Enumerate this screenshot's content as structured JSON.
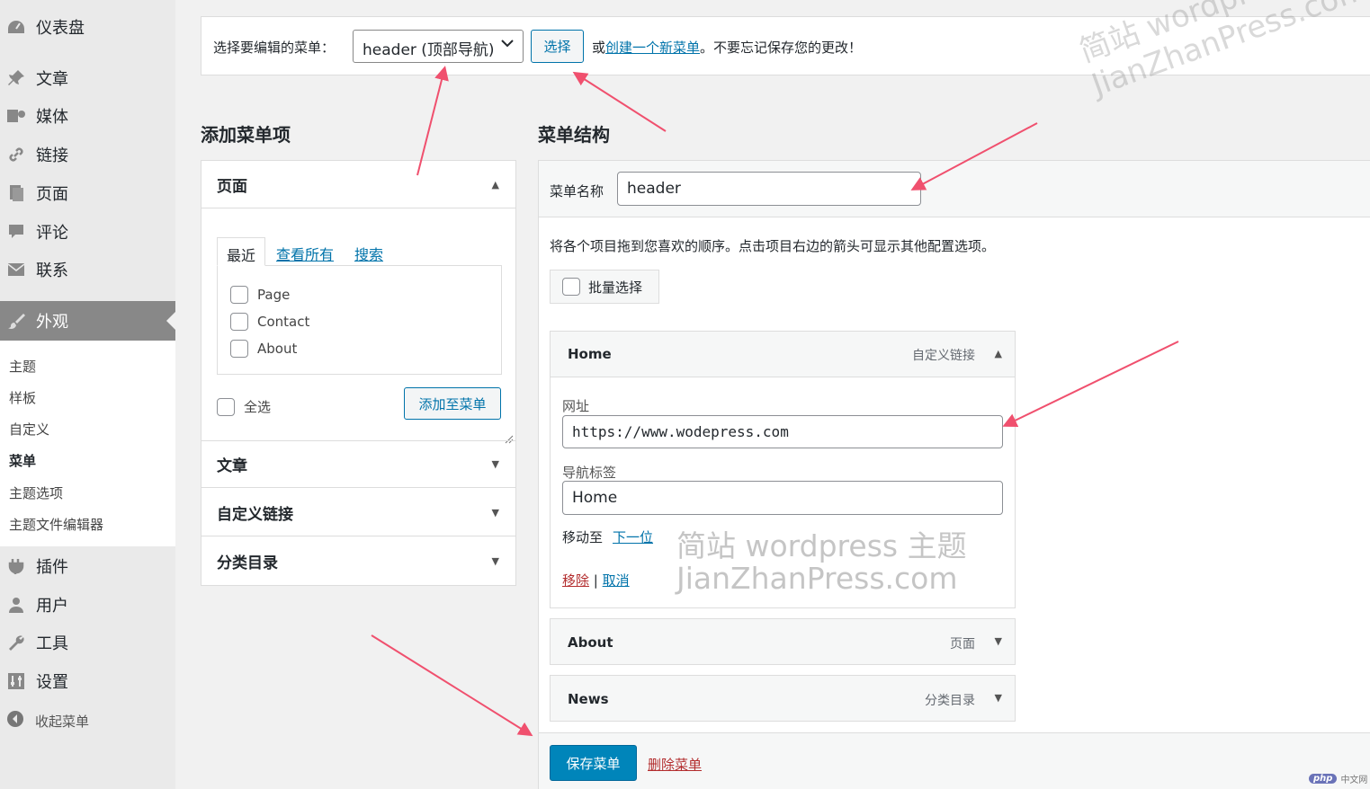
{
  "sidebar": {
    "items": [
      {
        "label": "仪表盘",
        "icon": "dashboard-icon"
      },
      {
        "label": "文章",
        "icon": "pin-icon"
      },
      {
        "label": "媒体",
        "icon": "media-icon"
      },
      {
        "label": "链接",
        "icon": "link-icon"
      },
      {
        "label": "页面",
        "icon": "page-icon"
      },
      {
        "label": "评论",
        "icon": "comment-icon"
      },
      {
        "label": "联系",
        "icon": "mail-icon"
      },
      {
        "label": "外观",
        "icon": "paintbrush-icon"
      },
      {
        "label": "插件",
        "icon": "plugin-icon"
      },
      {
        "label": "用户",
        "icon": "user-icon"
      },
      {
        "label": "工具",
        "icon": "wrench-icon"
      },
      {
        "label": "设置",
        "icon": "settings-icon"
      }
    ],
    "submenu": [
      "主题",
      "样板",
      "自定义",
      "菜单",
      "主题选项",
      "主题文件编辑器"
    ],
    "collapse_label": "收起菜单"
  },
  "select_bar": {
    "label": "选择要编辑的菜单：",
    "selected": "header (顶部导航)",
    "button": "选择",
    "tip_prefix": "或",
    "tip_link": "创建一个新菜单",
    "tip_suffix": "。不要忘记保存您的更改！"
  },
  "left": {
    "heading": "添加菜单项",
    "pages_title": "页面",
    "tabs": [
      "最近",
      "查看所有",
      "搜索"
    ],
    "pages": [
      "Page",
      "Contact",
      "About"
    ],
    "select_all": "全选",
    "add_button": "添加至菜单",
    "sections": [
      "文章",
      "自定义链接",
      "分类目录"
    ]
  },
  "right": {
    "heading": "菜单结构",
    "name_label": "菜单名称",
    "name_value": "header",
    "instruction": "将各个项目拖到您喜欢的顺序。点击项目右边的箭头可显示其他配置选项。",
    "bulk_select": "批量选择",
    "items": [
      {
        "title": "Home",
        "type": "自定义链接"
      },
      {
        "title": "About",
        "type": "页面"
      },
      {
        "title": "News",
        "type": "分类目录"
      }
    ],
    "url_label": "网址",
    "url_value": "https://www.wodepress.com",
    "nav_label": "导航标签",
    "nav_value": "Home",
    "move_label": "移动至",
    "move_link": "下一位",
    "remove": "移除",
    "separator": "|",
    "cancel": "取消",
    "save_button": "保存菜单",
    "delete_link": "删除菜单"
  },
  "watermark": {
    "line1": "简站 wordpress 主题",
    "line2": "JianZhanPress.com"
  },
  "badge": {
    "pill": "php",
    "text": "中文网"
  },
  "colors": {
    "accent": "#0073aa",
    "primary_button": "#0085ba",
    "danger": "#b32d2e",
    "annotation": "#f0506e"
  }
}
